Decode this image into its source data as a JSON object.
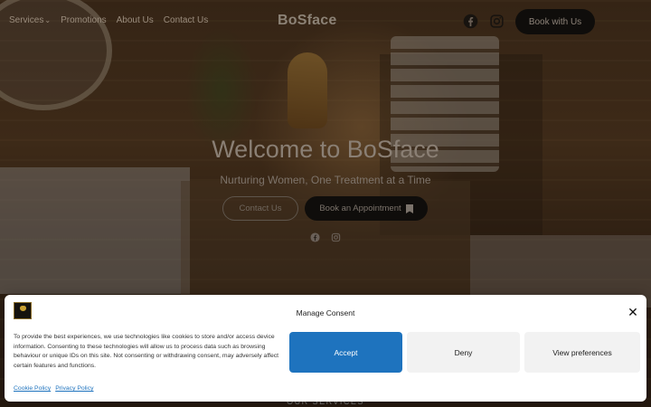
{
  "nav": {
    "links": [
      {
        "label": "Services",
        "has_dropdown": true
      },
      {
        "label": "Promotions"
      },
      {
        "label": "About Us"
      },
      {
        "label": "Contact Us"
      }
    ],
    "logo": "BoSface",
    "icons": [
      "facebook-icon",
      "instagram-icon"
    ],
    "book_label": "Book with Us"
  },
  "hero": {
    "title": "Welcome to BoSface",
    "subtitle": "Nurturing Women, One Treatment at a Time",
    "contact_label": "Contact Us",
    "appointment_label": "Book an Appointment",
    "icons": [
      "facebook-icon",
      "instagram-icon"
    ]
  },
  "services_heading": "OUR SERVICES",
  "consent": {
    "title": "Manage Consent",
    "body": "To provide the best experiences, we use technologies like cookies to store and/or access device information. Consenting to these technologies will allow us to process data such as browsing behaviour or unique IDs on this site. Not consenting or withdrawing consent, may adversely affect certain features and functions.",
    "accept_label": "Accept",
    "deny_label": "Deny",
    "preferences_label": "View preferences",
    "links": [
      "Cookie Policy",
      "Privacy Policy"
    ],
    "close_glyph": "✕"
  },
  "colors": {
    "accent": "#1e73be",
    "dark_button": "#0f0d0b"
  }
}
